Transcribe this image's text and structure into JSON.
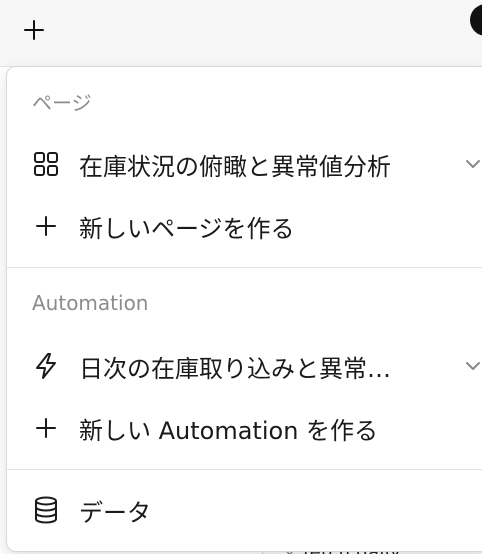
{
  "topbar": {
    "add_icon": "plus-icon"
  },
  "background": {
    "partial_text": "fetch daily"
  },
  "menu": {
    "pages_section": {
      "label": "ページ",
      "items": [
        {
          "label": "在庫状況の俯瞰と異常値分析",
          "icon": "grid-icon",
          "has_chevron": true
        },
        {
          "label": "新しいページを作る",
          "icon": "plus-icon",
          "has_chevron": false
        }
      ]
    },
    "automation_section": {
      "label": "Automation",
      "items": [
        {
          "label": "日次の在庫取り込みと異常…",
          "icon": "lightning-icon",
          "has_chevron": true
        },
        {
          "label": "新しい Automation を作る",
          "icon": "plus-icon",
          "has_chevron": false
        }
      ]
    },
    "data_item": {
      "label": "データ",
      "icon": "database-icon"
    }
  },
  "colors": {
    "text": "#1a1a1a",
    "muted": "#8c8c8c",
    "divider": "#e3e3e3",
    "topbar_bg": "#f7f7f7"
  }
}
